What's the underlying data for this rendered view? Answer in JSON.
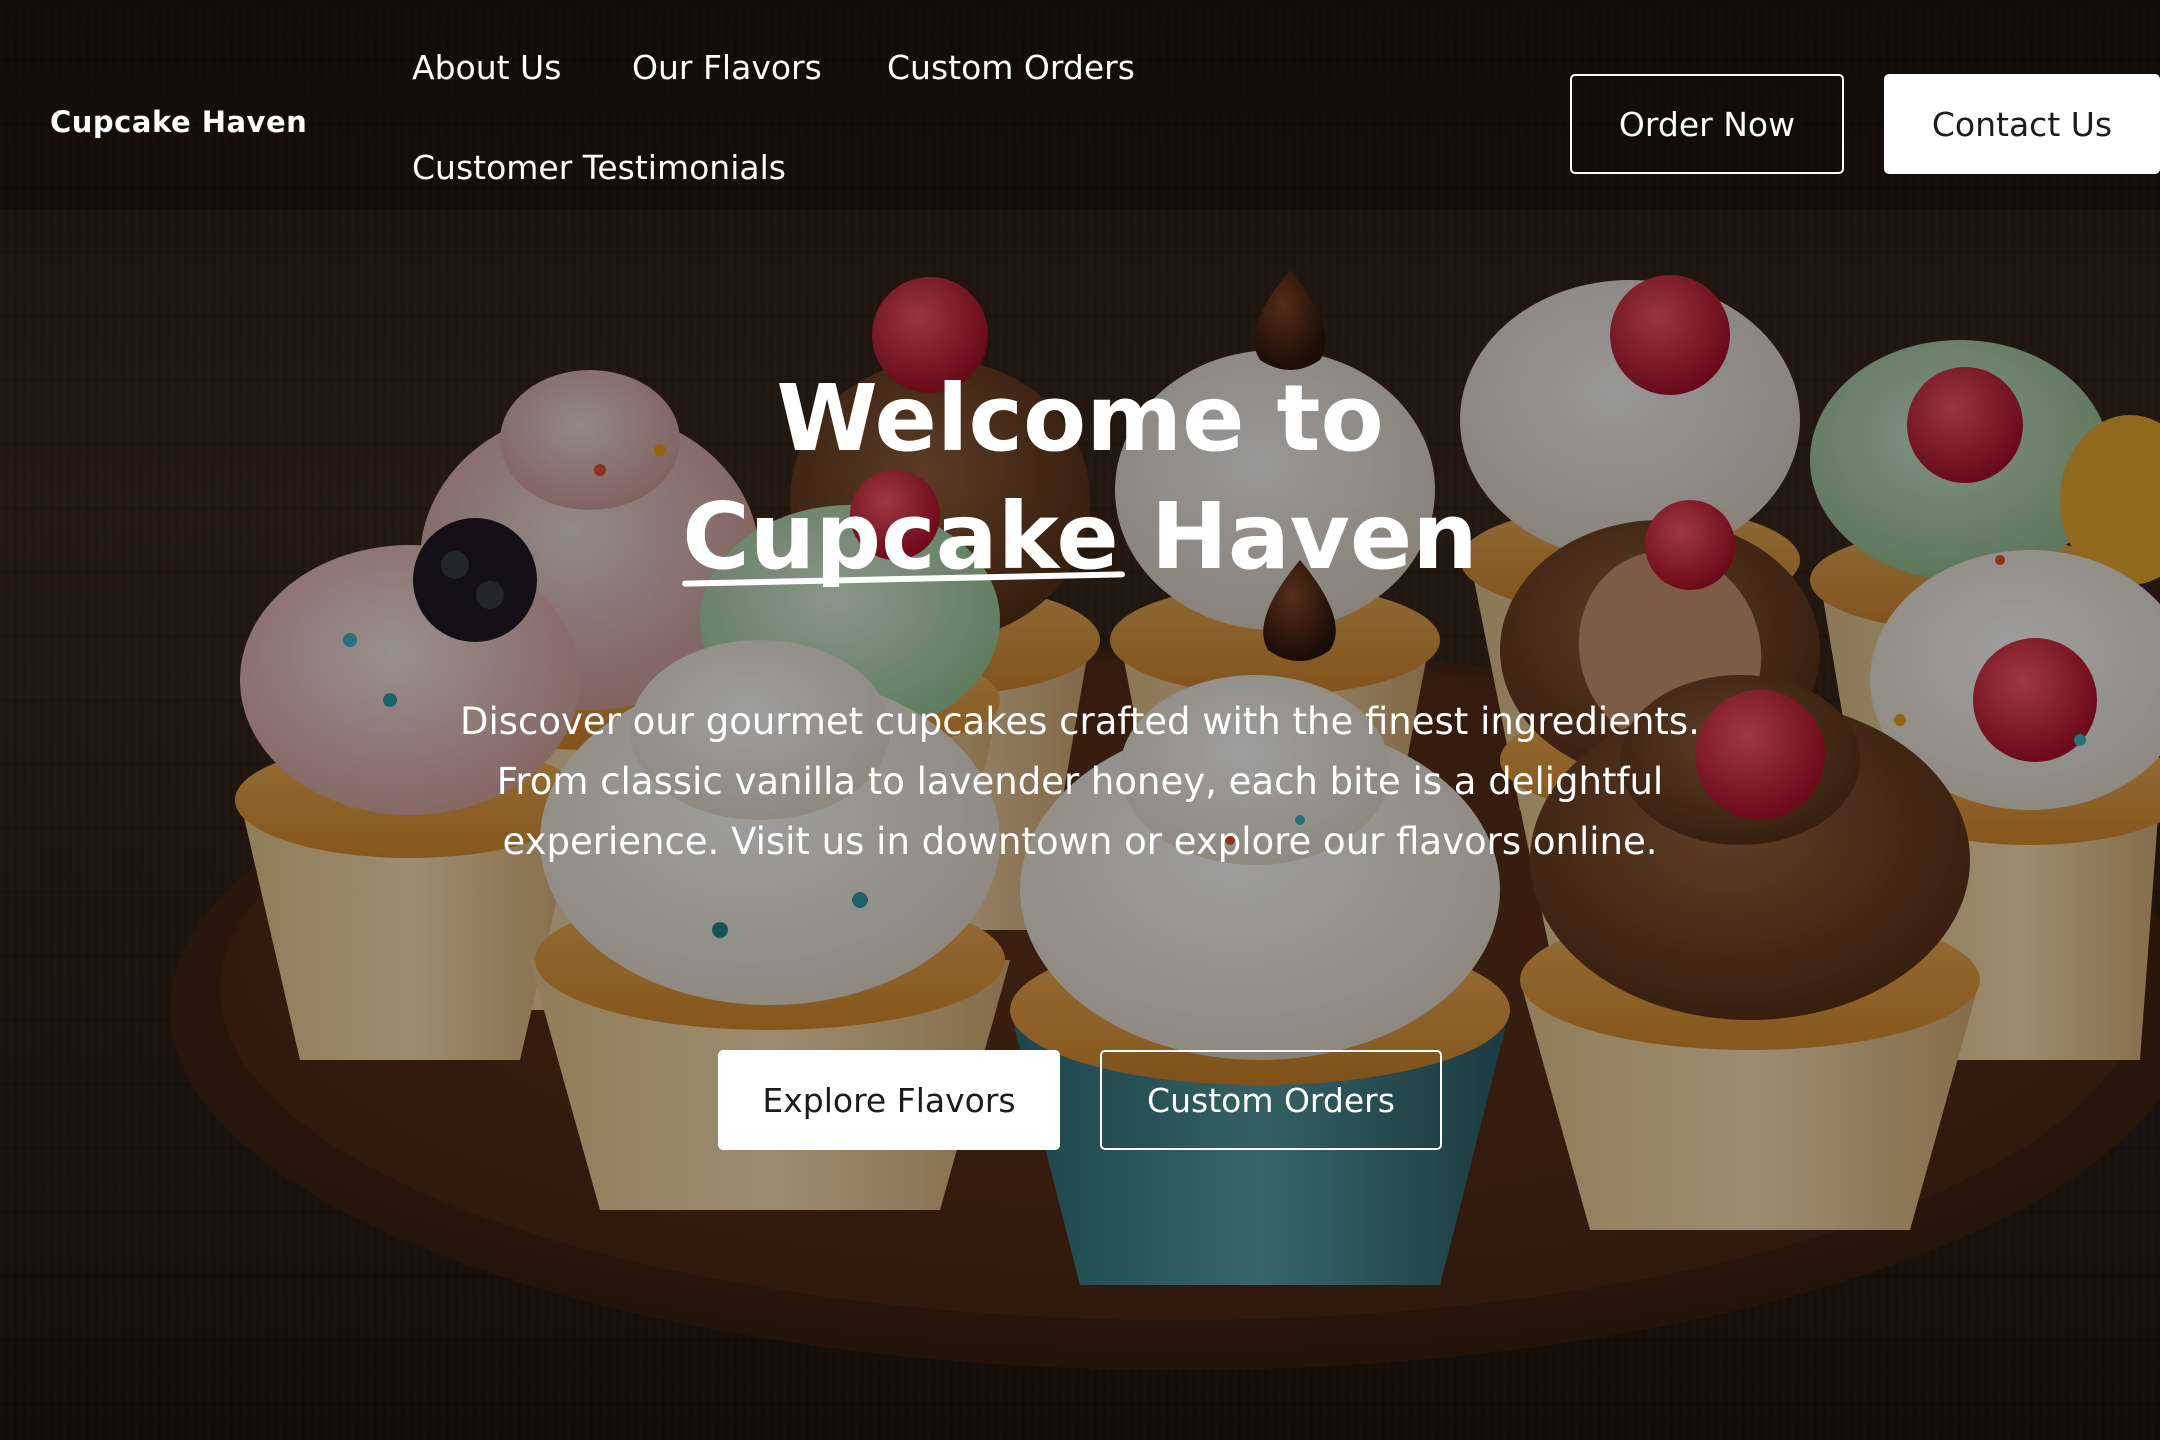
{
  "brand": {
    "name": "Cupcake Haven"
  },
  "nav": {
    "links": [
      "About Us",
      "Our Flavors",
      "Custom Orders",
      "Customer Testimonials"
    ]
  },
  "header_actions": {
    "order_now": "Order Now",
    "contact_us": "Contact Us"
  },
  "hero": {
    "title_line1": "Welcome to",
    "title_word_underlined": "Cupcake",
    "title_word_rest": "Haven",
    "subtitle": "Discover our gourmet cupcakes crafted with the finest ingredients. From classic vanilla to lavender honey, each bite is a delightful experience. Visit us in downtown or explore our flavors online.",
    "primary_cta": "Explore Flavors",
    "secondary_cta": "Custom Orders"
  },
  "colors": {
    "text": "#ffffff",
    "button_solid_bg": "#ffffff",
    "button_solid_text": "#1c1c1c",
    "background_wood": "#2f2017"
  }
}
